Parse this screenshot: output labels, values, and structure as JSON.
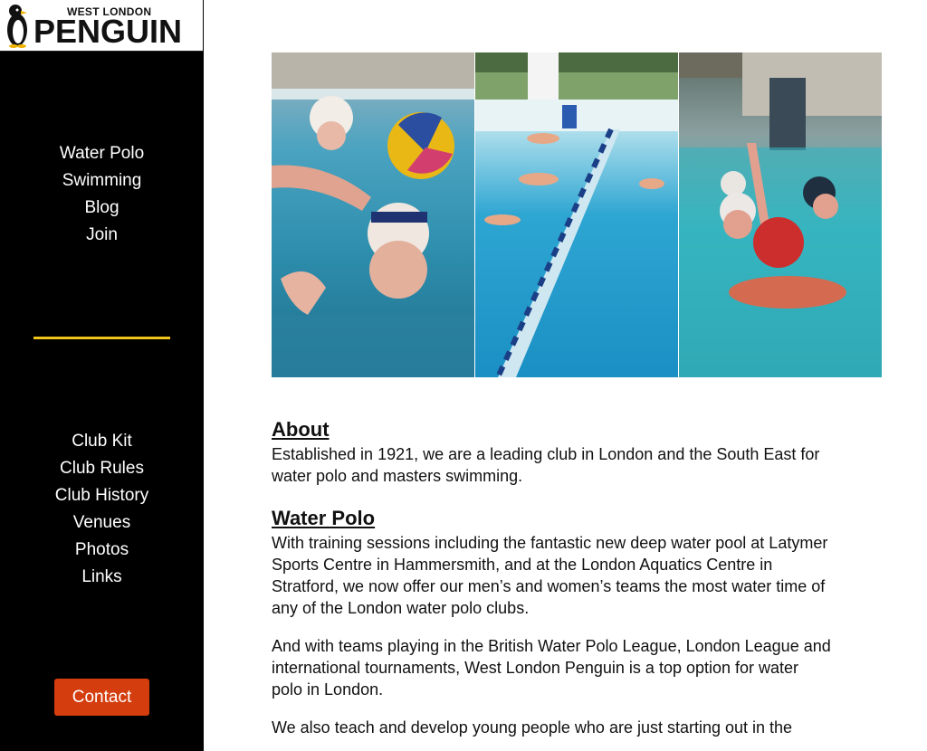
{
  "logo": {
    "line1": "WEST LONDON",
    "line2": "PENGUIN"
  },
  "nav_primary": [
    "Water Polo",
    "Swimming",
    "Blog",
    "Join"
  ],
  "nav_secondary": [
    "Club Kit",
    "Club Rules",
    "Club History",
    "Venues",
    "Photos",
    "Links"
  ],
  "contact_button": "Contact",
  "colors": {
    "sidebar_bg": "#000000",
    "divider": "#f0c419",
    "contact_bg": "#d43d0e"
  },
  "sections": {
    "about": {
      "heading": "About",
      "body": "Established in 1921, we are a leading club in London and the South East for water polo and masters swimming."
    },
    "water_polo": {
      "heading": "Water Polo",
      "p1": "With training sessions including the fantastic new deep water pool at Latymer Sports Centre in Hammersmith, and at the London Aquatics Centre in Stratford, we now offer our men’s and women’s teams the most water time of any of the London water polo clubs.",
      "p2": "And with teams playing in the British Water Polo League, London League and international tournaments, West London Penguin is a top option for water polo in London.",
      "p3": "We also teach and develop young people who are just starting out in the"
    }
  }
}
